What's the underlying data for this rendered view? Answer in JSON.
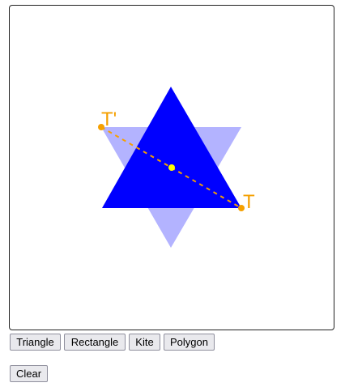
{
  "canvas": {
    "labels": {
      "target": "T",
      "target_prime": "T'"
    },
    "colors": {
      "shape": "#0000ff",
      "reflected_shape": "#b3b3ff",
      "handle": "#f5a000",
      "center": "#ffff00"
    }
  },
  "toolbar": {
    "triangle_label": "Triangle",
    "rectangle_label": "Rectangle",
    "kite_label": "Kite",
    "polygon_label": "Polygon"
  },
  "actions": {
    "clear_label": "Clear"
  }
}
